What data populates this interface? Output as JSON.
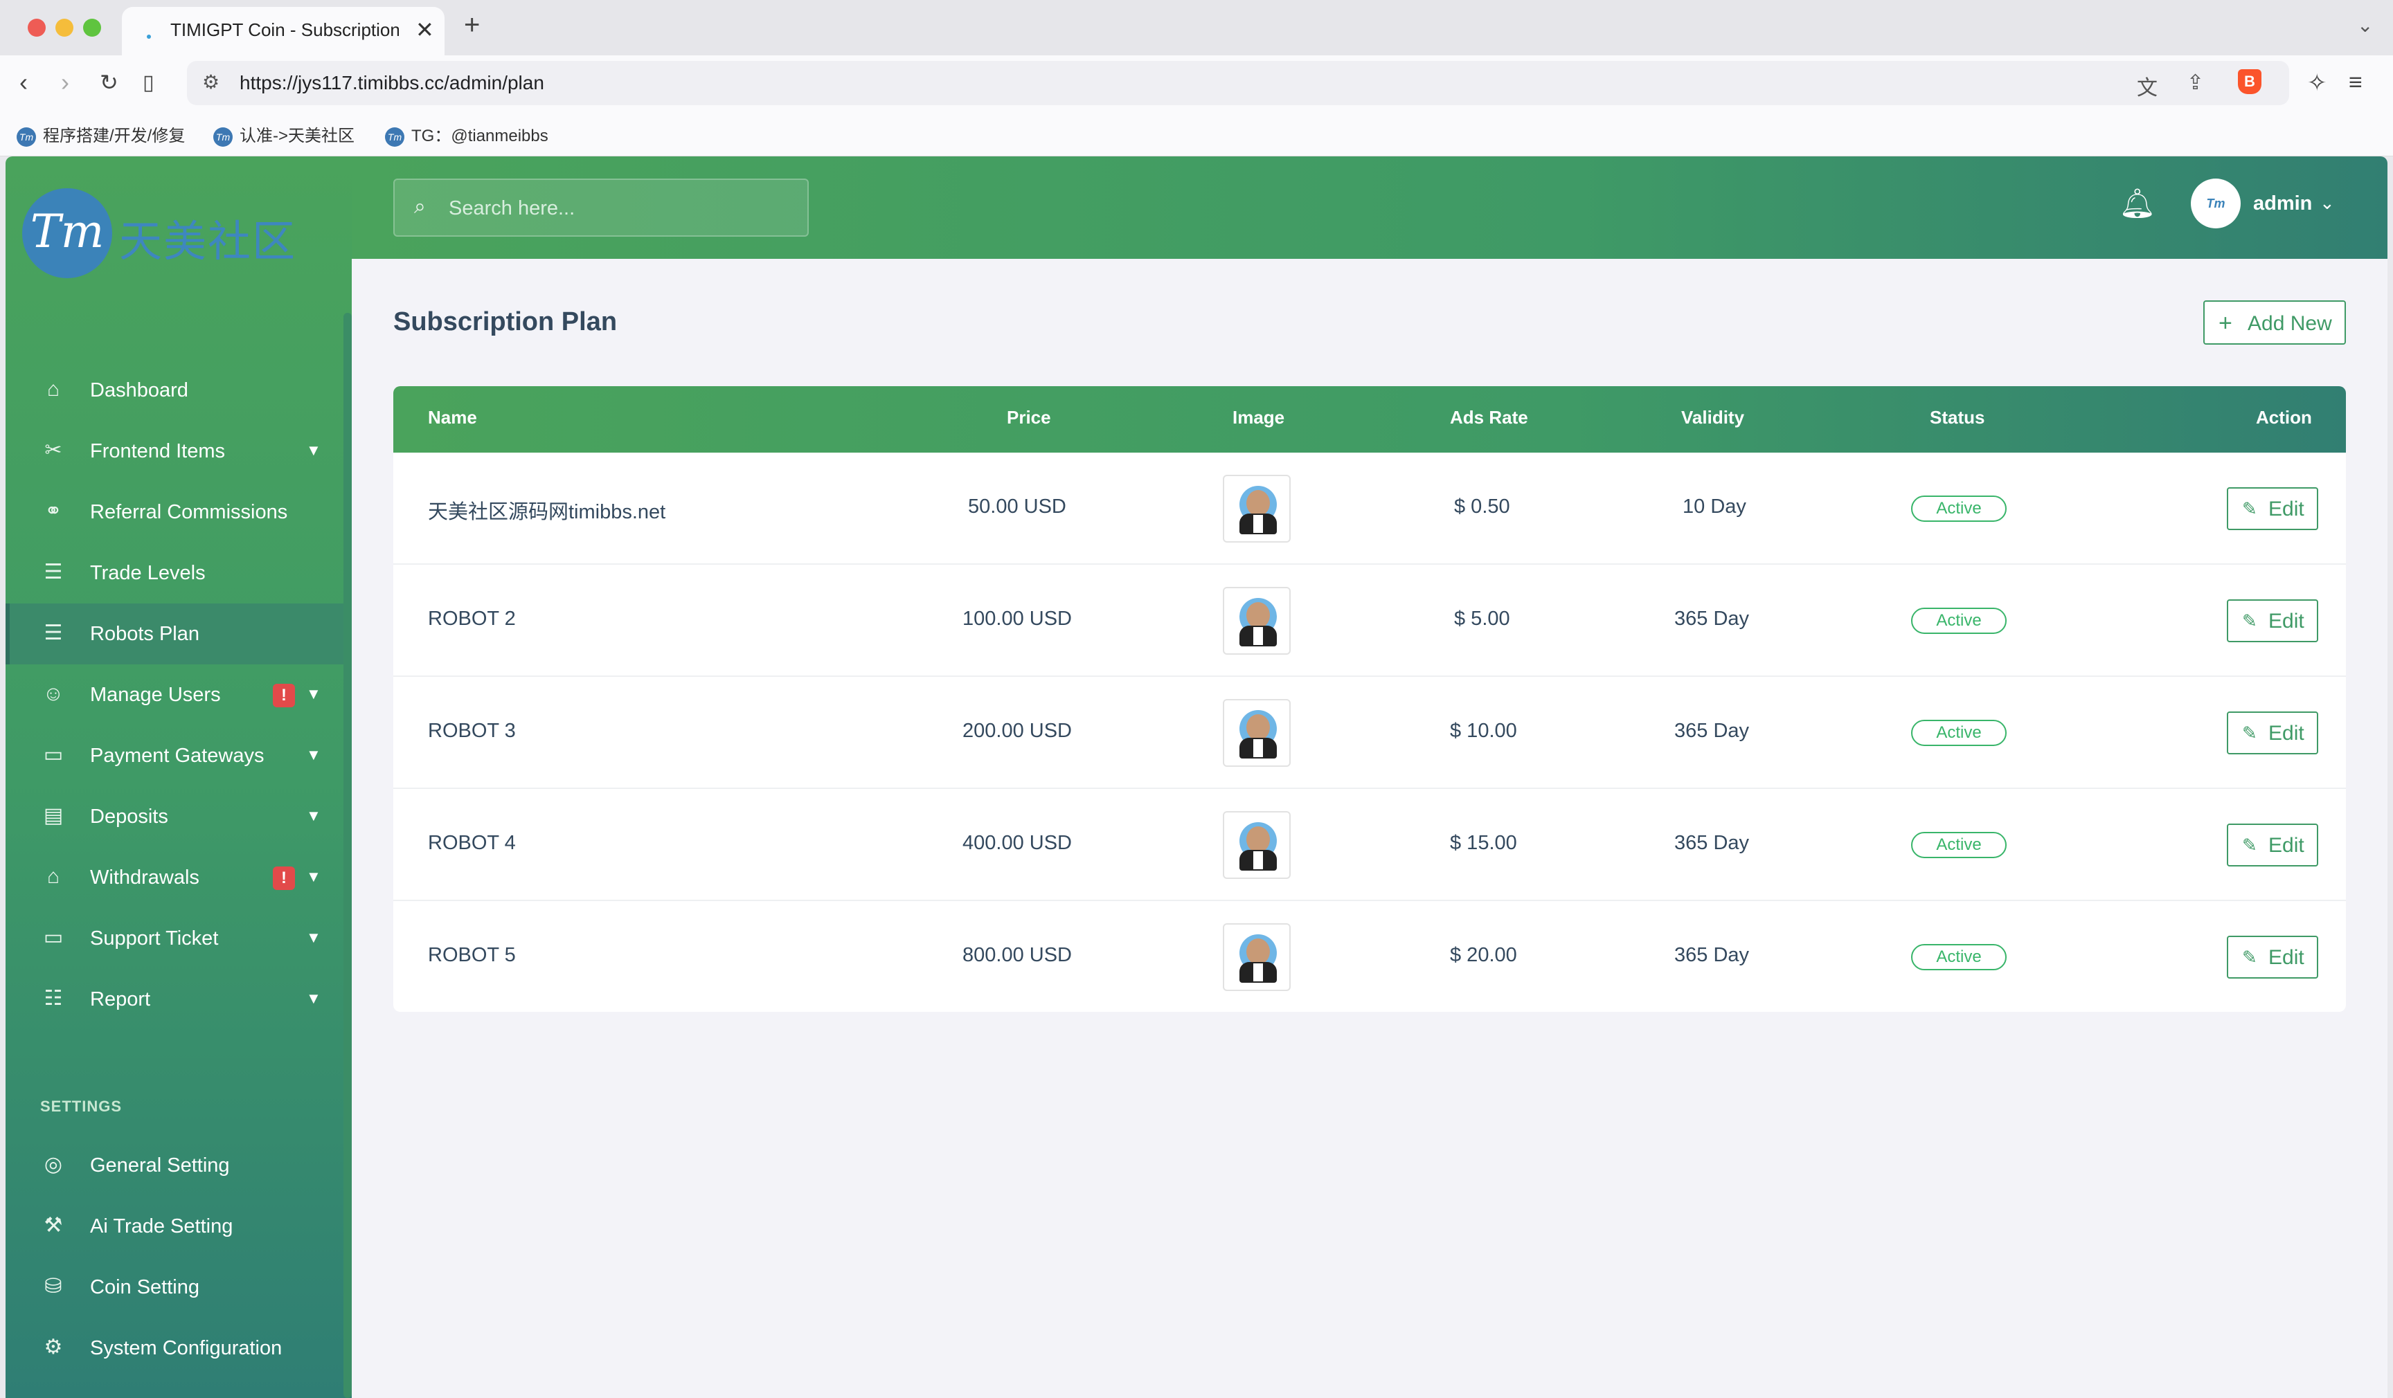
{
  "browser": {
    "tab_title": "TIMIGPT Coin - Subscription",
    "url": "https://jys117.timibbs.cc/admin/plan",
    "bookmarks": [
      "程序搭建/开发/修复",
      "认准->天美社区",
      "TG：@tianmeibbs"
    ]
  },
  "brand": {
    "logo_mark": "Tm",
    "logo_text": "天美社区"
  },
  "sidebar": {
    "items": [
      {
        "label": "Dashboard",
        "icon": "home-icon"
      },
      {
        "label": "Frontend Items",
        "icon": "tools-icon"
      },
      {
        "label": "Referral Commissions",
        "icon": "link-icon"
      },
      {
        "label": "Trade Levels",
        "icon": "list-icon"
      },
      {
        "label": "Robots Plan",
        "icon": "list-icon"
      },
      {
        "label": "Manage Users",
        "icon": "users-icon",
        "badge": "!"
      },
      {
        "label": "Payment Gateways",
        "icon": "card-icon"
      },
      {
        "label": "Deposits",
        "icon": "document-icon"
      },
      {
        "label": "Withdrawals",
        "icon": "bank-icon",
        "badge": "!"
      },
      {
        "label": "Support Ticket",
        "icon": "ticket-icon"
      },
      {
        "label": "Report",
        "icon": "report-icon"
      }
    ],
    "settings_title": "SETTINGS",
    "settings_items": [
      {
        "label": "General Setting",
        "icon": "lifebuoy-icon"
      },
      {
        "label": "Ai Trade Setting",
        "icon": "hammer-icon"
      },
      {
        "label": "Coin Setting",
        "icon": "coins-icon"
      },
      {
        "label": "System Configuration",
        "icon": "gear-icon"
      }
    ]
  },
  "header": {
    "search_placeholder": "Search here...",
    "user_name": "admin"
  },
  "page": {
    "title": "Subscription Plan",
    "add_label": "Add New"
  },
  "table": {
    "columns": [
      "Name",
      "Price",
      "Image",
      "Ads Rate",
      "Validity",
      "Status",
      "Action"
    ],
    "rows": [
      {
        "name": "天美社区源码网timibbs.net",
        "price": "50.00 USD",
        "ads_rate": "$ 0.50",
        "validity": "10 Day",
        "status": "Active",
        "action": "Edit"
      },
      {
        "name": "ROBOT 2",
        "price": "100.00 USD",
        "ads_rate": "$ 5.00",
        "validity": "365 Day",
        "status": "Active",
        "action": "Edit"
      },
      {
        "name": "ROBOT 3",
        "price": "200.00 USD",
        "ads_rate": "$ 10.00",
        "validity": "365 Day",
        "status": "Active",
        "action": "Edit"
      },
      {
        "name": "ROBOT 4",
        "price": "400.00 USD",
        "ads_rate": "$ 15.00",
        "validity": "365 Day",
        "status": "Active",
        "action": "Edit"
      },
      {
        "name": "ROBOT 5",
        "price": "800.00 USD",
        "ads_rate": "$ 20.00",
        "validity": "365 Day",
        "status": "Active",
        "action": "Edit"
      }
    ]
  },
  "colors": {
    "accent": "#3f9a66",
    "sidebar_top": "#4aa35c",
    "sidebar_bottom": "#2f7e74",
    "badge": "#e24a4a",
    "status_active": "#39b56a"
  }
}
